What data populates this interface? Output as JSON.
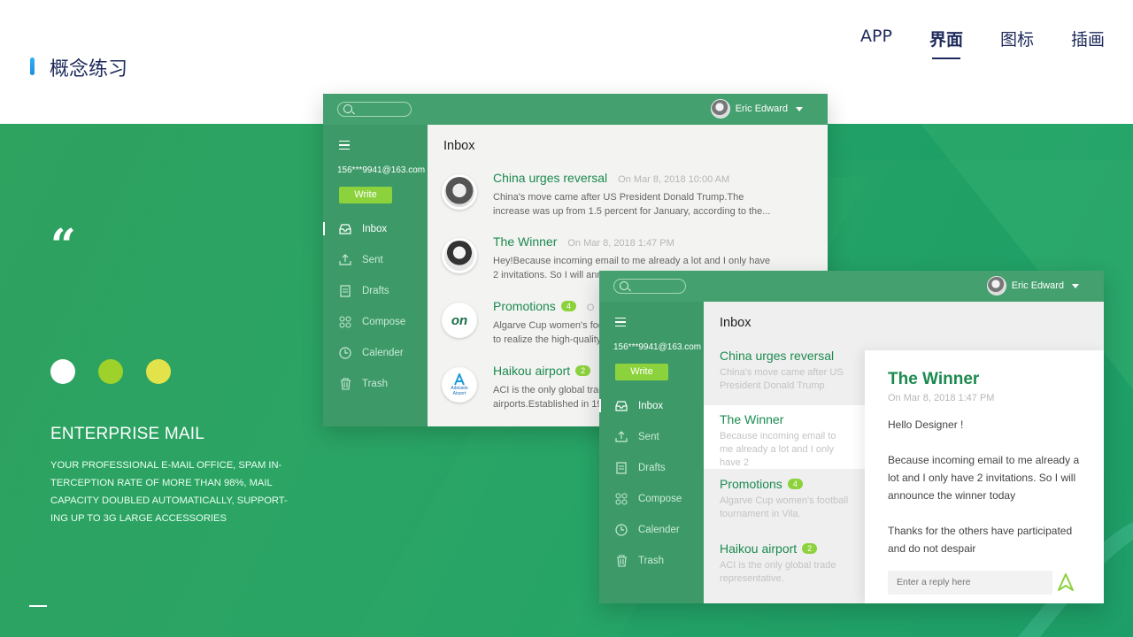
{
  "header": {
    "title": "概念练习",
    "nav": [
      "APP",
      "界面",
      "图标",
      "插画"
    ],
    "active": 1
  },
  "intro": {
    "quote_mark": "“",
    "dot_colors": [
      "#ffffff",
      "#9ed22a",
      "#e2e24a"
    ],
    "title": "ENTERPRISE MAIL",
    "description_lines": [
      "YOUR PROFESSIONAL E-MAIL OFFICE, SPAM IN-",
      "TERCEPTION RATE OF MORE THAN 98%, MAIL",
      "CAPACITY DOUBLED AUTOMATICALLY, SUPPORT-",
      "ING UP TO 3G LARGE ACCESSORIES"
    ]
  },
  "mail_app": {
    "user_name": "Eric Edward",
    "account": "156***9941@163.com",
    "write_label": "Write",
    "inbox_title": "Inbox",
    "nav": [
      {
        "label": "Inbox",
        "icon": "inbox-icon"
      },
      {
        "label": "Sent",
        "icon": "upload-icon"
      },
      {
        "label": "Drafts",
        "icon": "document-icon"
      },
      {
        "label": "Compose",
        "icon": "grid-icon"
      },
      {
        "label": "Calender",
        "icon": "clock-icon"
      },
      {
        "label": "Trash",
        "icon": "trash-icon"
      }
    ]
  },
  "window_a": {
    "emails": [
      {
        "subject": "China urges reversal",
        "badge": "",
        "date": "On Mar 8, 2018 10:00 AM",
        "preview": "China's move came after US President Donald Trump.The increase was up from 1.5 percent for January, according to the..."
      },
      {
        "subject": "The Winner",
        "badge": "",
        "date": "On Mar 8, 2018 1:47 PM",
        "preview": "Hey!Because incoming email to me already a lot and I only have 2 invitations. So I will announ"
      },
      {
        "subject": "Promotions",
        "badge": "4",
        "date": "O",
        "preview": "Algarve Cup women's foo to realize the high-quality"
      },
      {
        "subject": "Haikou airport",
        "badge": "2",
        "date": "",
        "preview": "ACI is the only global trac airports.Established in 19"
      }
    ],
    "avatar_labels": [
      "on",
      "Adelaide Airport"
    ]
  },
  "window_b": {
    "emails": [
      {
        "subject": "China urges reversal",
        "badge": "",
        "preview": "China's move came after US President Donald Trump"
      },
      {
        "subject": "The Winner",
        "badge": "",
        "preview": "Because incoming email to me already a lot and I only have 2"
      },
      {
        "subject": "Promotions",
        "badge": "4",
        "preview": "Algarve Cup women's football tournament in Vila."
      },
      {
        "subject": "Haikou airport",
        "badge": "2",
        "preview": "ACI is the only global trade representative."
      }
    ],
    "reader": {
      "title": "The Winner",
      "date": "On Mar 8, 2018 1:47 PM",
      "greeting": "Hello Designer !",
      "body1": "Because incoming email to me already a lot and I only have 2 invitations. So I will announce the winner today",
      "body2": "Thanks for the others have participated and do not despair",
      "reply_placeholder": "Enter a reply here"
    }
  }
}
